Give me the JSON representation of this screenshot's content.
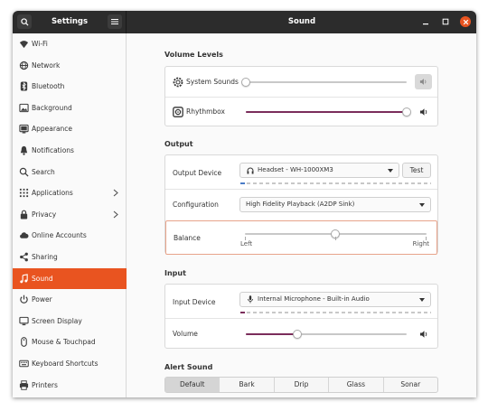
{
  "window": {
    "sidebar_title": "Settings",
    "title": "Sound"
  },
  "sidebar": {
    "items": [
      {
        "label": "Wi-Fi",
        "icon": "wifi-icon"
      },
      {
        "label": "Network",
        "icon": "network-icon"
      },
      {
        "label": "Bluetooth",
        "icon": "bluetooth-icon"
      },
      {
        "label": "Background",
        "icon": "background-icon"
      },
      {
        "label": "Appearance",
        "icon": "appearance-icon"
      },
      {
        "label": "Notifications",
        "icon": "bell-icon"
      },
      {
        "label": "Search",
        "icon": "search-icon"
      },
      {
        "label": "Applications",
        "icon": "grid-icon",
        "has_chevron": true
      },
      {
        "label": "Privacy",
        "icon": "lock-icon",
        "has_chevron": true
      },
      {
        "label": "Online Accounts",
        "icon": "cloud-icon"
      },
      {
        "label": "Sharing",
        "icon": "share-icon"
      },
      {
        "label": "Sound",
        "icon": "music-note-icon",
        "active": true
      },
      {
        "label": "Power",
        "icon": "power-icon"
      },
      {
        "label": "Screen Display",
        "icon": "display-icon"
      },
      {
        "label": "Mouse & Touchpad",
        "icon": "mouse-icon"
      },
      {
        "label": "Keyboard Shortcuts",
        "icon": "keyboard-icon"
      },
      {
        "label": "Printers",
        "icon": "printer-icon"
      }
    ]
  },
  "volume_levels": {
    "title": "Volume Levels",
    "apps": [
      {
        "label": "System Sounds",
        "level": 0.0,
        "muted": true
      },
      {
        "label": "Rhythmbox",
        "level": 1.0,
        "muted": false
      }
    ]
  },
  "output": {
    "title": "Output",
    "device_label": "Output Device",
    "device_value": "Headset - WH-1000XM3",
    "test_label": "Test",
    "configuration_label": "Configuration",
    "configuration_value": "High Fidelity Playback (A2DP Sink)",
    "balance_label": "Balance",
    "balance_left": "Left",
    "balance_right": "Right",
    "balance_value": 0.5,
    "level_meter": 0.02
  },
  "input": {
    "title": "Input",
    "device_label": "Input Device",
    "device_value": "Internal Microphone - Built-in Audio",
    "volume_label": "Volume",
    "volume_value": 0.32,
    "level_meter": 0.02
  },
  "alert_sound": {
    "title": "Alert Sound",
    "options": [
      "Default",
      "Bark",
      "Drip",
      "Glass",
      "Sonar"
    ],
    "selected": "Default"
  },
  "colors": {
    "accent": "#e95420",
    "slider_fill": "#7b2d5b",
    "headerbar": "#2c2c2c",
    "level_meter": "#4a7cc7"
  }
}
